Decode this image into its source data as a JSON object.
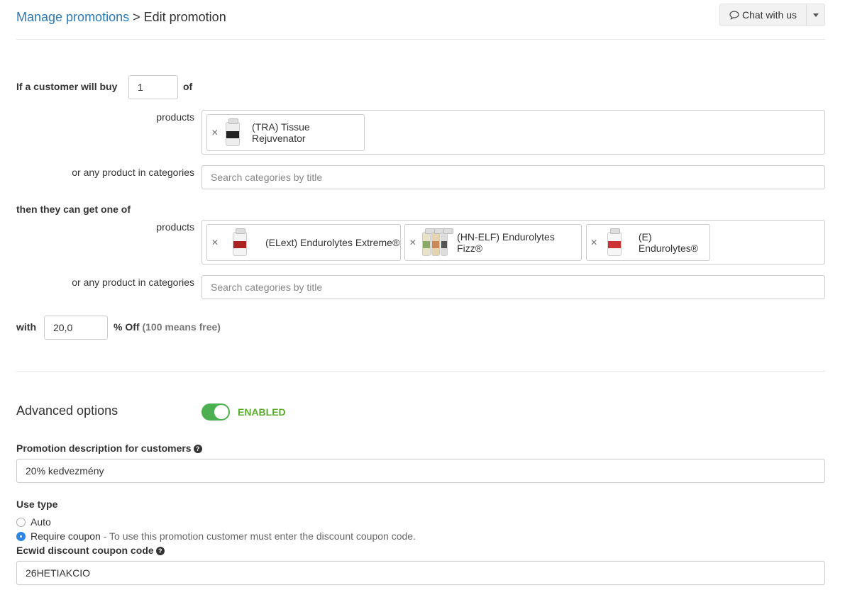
{
  "breadcrumb": {
    "parent": "Manage promotions",
    "separator": ">",
    "current": "Edit promotion"
  },
  "chat": {
    "label": "Chat with us"
  },
  "buy": {
    "prefix": "If a customer will buy",
    "quantity": "1",
    "suffix": "of",
    "products_label": "products",
    "products": [
      {
        "name": "(TRA) Tissue Rejuvenator"
      }
    ],
    "categories_label": "or any product in categories",
    "categories_placeholder": "Search categories by title"
  },
  "get": {
    "heading": "then they can get one of",
    "products_label": "products",
    "products": [
      {
        "name": "(ELext) Endurolytes Extreme®"
      },
      {
        "name": "(HN-ELF) Endurolytes Fizz®"
      },
      {
        "name": "(E) Endurolytes®"
      }
    ],
    "categories_label": "or any product in categories",
    "categories_placeholder": "Search categories by title"
  },
  "discount": {
    "prefix": "with",
    "value": "20,0",
    "suffix": "% Off",
    "note": "(100 means free)"
  },
  "advanced": {
    "title": "Advanced options",
    "toggle_state": "ENABLED",
    "enabled": true
  },
  "description": {
    "label": "Promotion description for customers",
    "value": "20% kedvezmény"
  },
  "use_type": {
    "label": "Use type",
    "options": [
      {
        "label": "Auto",
        "selected": false
      },
      {
        "label": "Require coupon",
        "hint": "- To use this promotion customer must enter the discount coupon code.",
        "selected": true
      }
    ]
  },
  "coupon": {
    "label": "Ecwid discount coupon code",
    "value": "26HETIAKCIO"
  },
  "colors": {
    "link": "#2a7ab8",
    "toggle_on": "#4caf50",
    "enabled_text": "#5bab2f",
    "radio_selected": "#2d86e6"
  }
}
